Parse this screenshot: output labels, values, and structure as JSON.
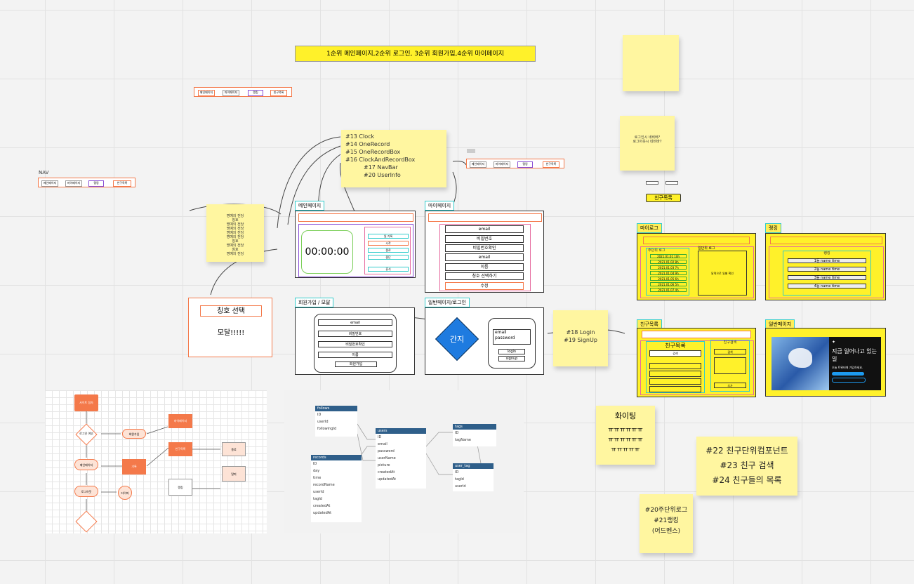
{
  "priority_banner": "1순위 메인페이지,2순위 로그인, 3순위 회원가입,4순위 마이페이지",
  "nav": {
    "label": "NAV",
    "items": [
      "메인페이지",
      "마이페이지",
      "랭킹",
      "친구목록"
    ]
  },
  "top_nav": {
    "items": [
      "메인페이지",
      "마이페이지",
      "랭킹",
      "친구목록"
    ]
  },
  "mid_nav": {
    "items": [
      "메인페이지",
      "마이페이지",
      "랭킹",
      "친구목록"
    ]
  },
  "tasks_note": {
    "lines": [
      "#13 Clock",
      "#14 OneRecord",
      "#15 OneRecordBox",
      "#16 ClockAndRecordBox",
      "#17 NavBar",
      "#20 UserInfo"
    ]
  },
  "main_page": {
    "title": "메인페이지",
    "clock": "00:00:00",
    "record_rows": [
      "일 기록",
      "시작",
      "종료",
      "중단",
      "휴식"
    ]
  },
  "mypage": {
    "title": "마이페이지",
    "rows": [
      "email",
      "비밀번호",
      "비밀번호확인",
      "email",
      "이름",
      "칭호 선택하기",
      "수정"
    ]
  },
  "signup": {
    "title": "회원가입 / 모달",
    "rows": [
      "email",
      "비밀번호",
      "비밀번호확인",
      "이름",
      "회원가입"
    ]
  },
  "login": {
    "title": "일반페이지/로그인",
    "diamond": "간지",
    "fields": [
      "email",
      "password"
    ],
    "buttons": [
      "login",
      "signup"
    ]
  },
  "login_note": {
    "lines": [
      "#18 Login",
      "#19 SignUp"
    ]
  },
  "title_modal": {
    "button": "칭호 선택",
    "text": "모달!!!!!"
  },
  "left_note": {
    "lines": [
      "명예의 전당",
      "칭호",
      "명예의 전당",
      "명예의 전당",
      "명예의 전당",
      "명예의 전당",
      "칭호",
      "명예의 전당",
      "칭호",
      "명예의 전당"
    ]
  },
  "right_question": {
    "lines": [
      "로그인시 네비바?",
      "로그아웃시 네비바?"
    ]
  },
  "friend_list_chip": "친구목록",
  "my_log": {
    "title": "마이로그",
    "left_title": "주단위 로그",
    "right_title": "일단위 로그",
    "right_text": "달력으로 일별 확인",
    "rows": [
      "2021.01.01 10h",
      "2021.01.02 8h",
      "2021.01.03 7h",
      "2021.01.04 9h",
      "2021.01.05 6h",
      "2021.01.06 5h",
      "2021.01.07 4h"
    ]
  },
  "ranking": {
    "title": "랭킹",
    "subtitle": "랭킹",
    "rows": [
      "1등 name time",
      "2등 name time",
      "3등 name time",
      "4등 name time"
    ]
  },
  "friends_page": {
    "title": "친구목록",
    "left_title": "친구목록",
    "right_title": "친구검색",
    "search_placeholder": "검색",
    "right_buttons": [
      "검색",
      "추가"
    ]
  },
  "twitter_page": {
    "title": "일반페이지",
    "headline": "지금 일어나고 있는 일",
    "sub": "오늘 트위터에 가입하세요."
  },
  "fighting_note": {
    "title": "화이팅",
    "lines": [
      "ㅠㅠㅠㅠㅠㅠ",
      "ㅠㅠㅠㅠㅠㅠ",
      "ㅠㅠㅠㅠㅠ"
    ]
  },
  "friend_tasks": {
    "lines": [
      "#22 친구단위컴포넌트",
      "#23 친구 검색",
      "#24 친구들의 목록"
    ]
  },
  "log_tasks": {
    "lines": [
      "#20주단위로그",
      "#21랭킹",
      "(어드벤스)"
    ]
  },
  "flowchart": {
    "nodes": [
      "사이트 접속",
      "로그인 여부",
      "회원가입",
      "마이페이지",
      "메인페이지",
      "기록",
      "로그아웃",
      "타이머",
      "친구목록",
      "랭킹",
      "종료",
      "탈퇴"
    ]
  },
  "erd": {
    "tables": [
      {
        "name": "follows",
        "fields": [
          [
            "ID",
            "int"
          ],
          [
            "userId",
            "int"
          ],
          [
            "followingId",
            "int"
          ]
        ]
      },
      {
        "name": "users",
        "fields": [
          [
            "ID",
            "int"
          ],
          [
            "email",
            "varchar"
          ],
          [
            "password",
            "varchar"
          ],
          [
            "userName",
            "varchar"
          ],
          [
            "picture",
            "text"
          ],
          [
            "createdAt",
            "timestamp"
          ],
          [
            "updatedAt",
            "timestamp"
          ]
        ]
      },
      {
        "name": "tags",
        "fields": [
          [
            "ID",
            "int"
          ],
          [
            "tagName",
            "varchar"
          ]
        ]
      },
      {
        "name": "records",
        "fields": [
          [
            "ID",
            "int"
          ],
          [
            "day",
            "date"
          ],
          [
            "time",
            "int"
          ],
          [
            "recordName",
            "varchar"
          ],
          [
            "userId",
            "int"
          ],
          [
            "tagId",
            "int"
          ],
          [
            "createdAt",
            "timestamp"
          ],
          [
            "updatedAt",
            "timestamp"
          ]
        ]
      },
      {
        "name": "user_tag",
        "fields": [
          [
            "ID",
            "int"
          ],
          [
            "tagId",
            "int"
          ],
          [
            "userId",
            "int"
          ]
        ]
      }
    ]
  },
  "colors": {
    "sticky": "#fff6a0",
    "banner": "#fff12a",
    "accent_orange": "#f4794a",
    "frame_border": "#3cc",
    "ranking_yellow": "#ffee58"
  }
}
